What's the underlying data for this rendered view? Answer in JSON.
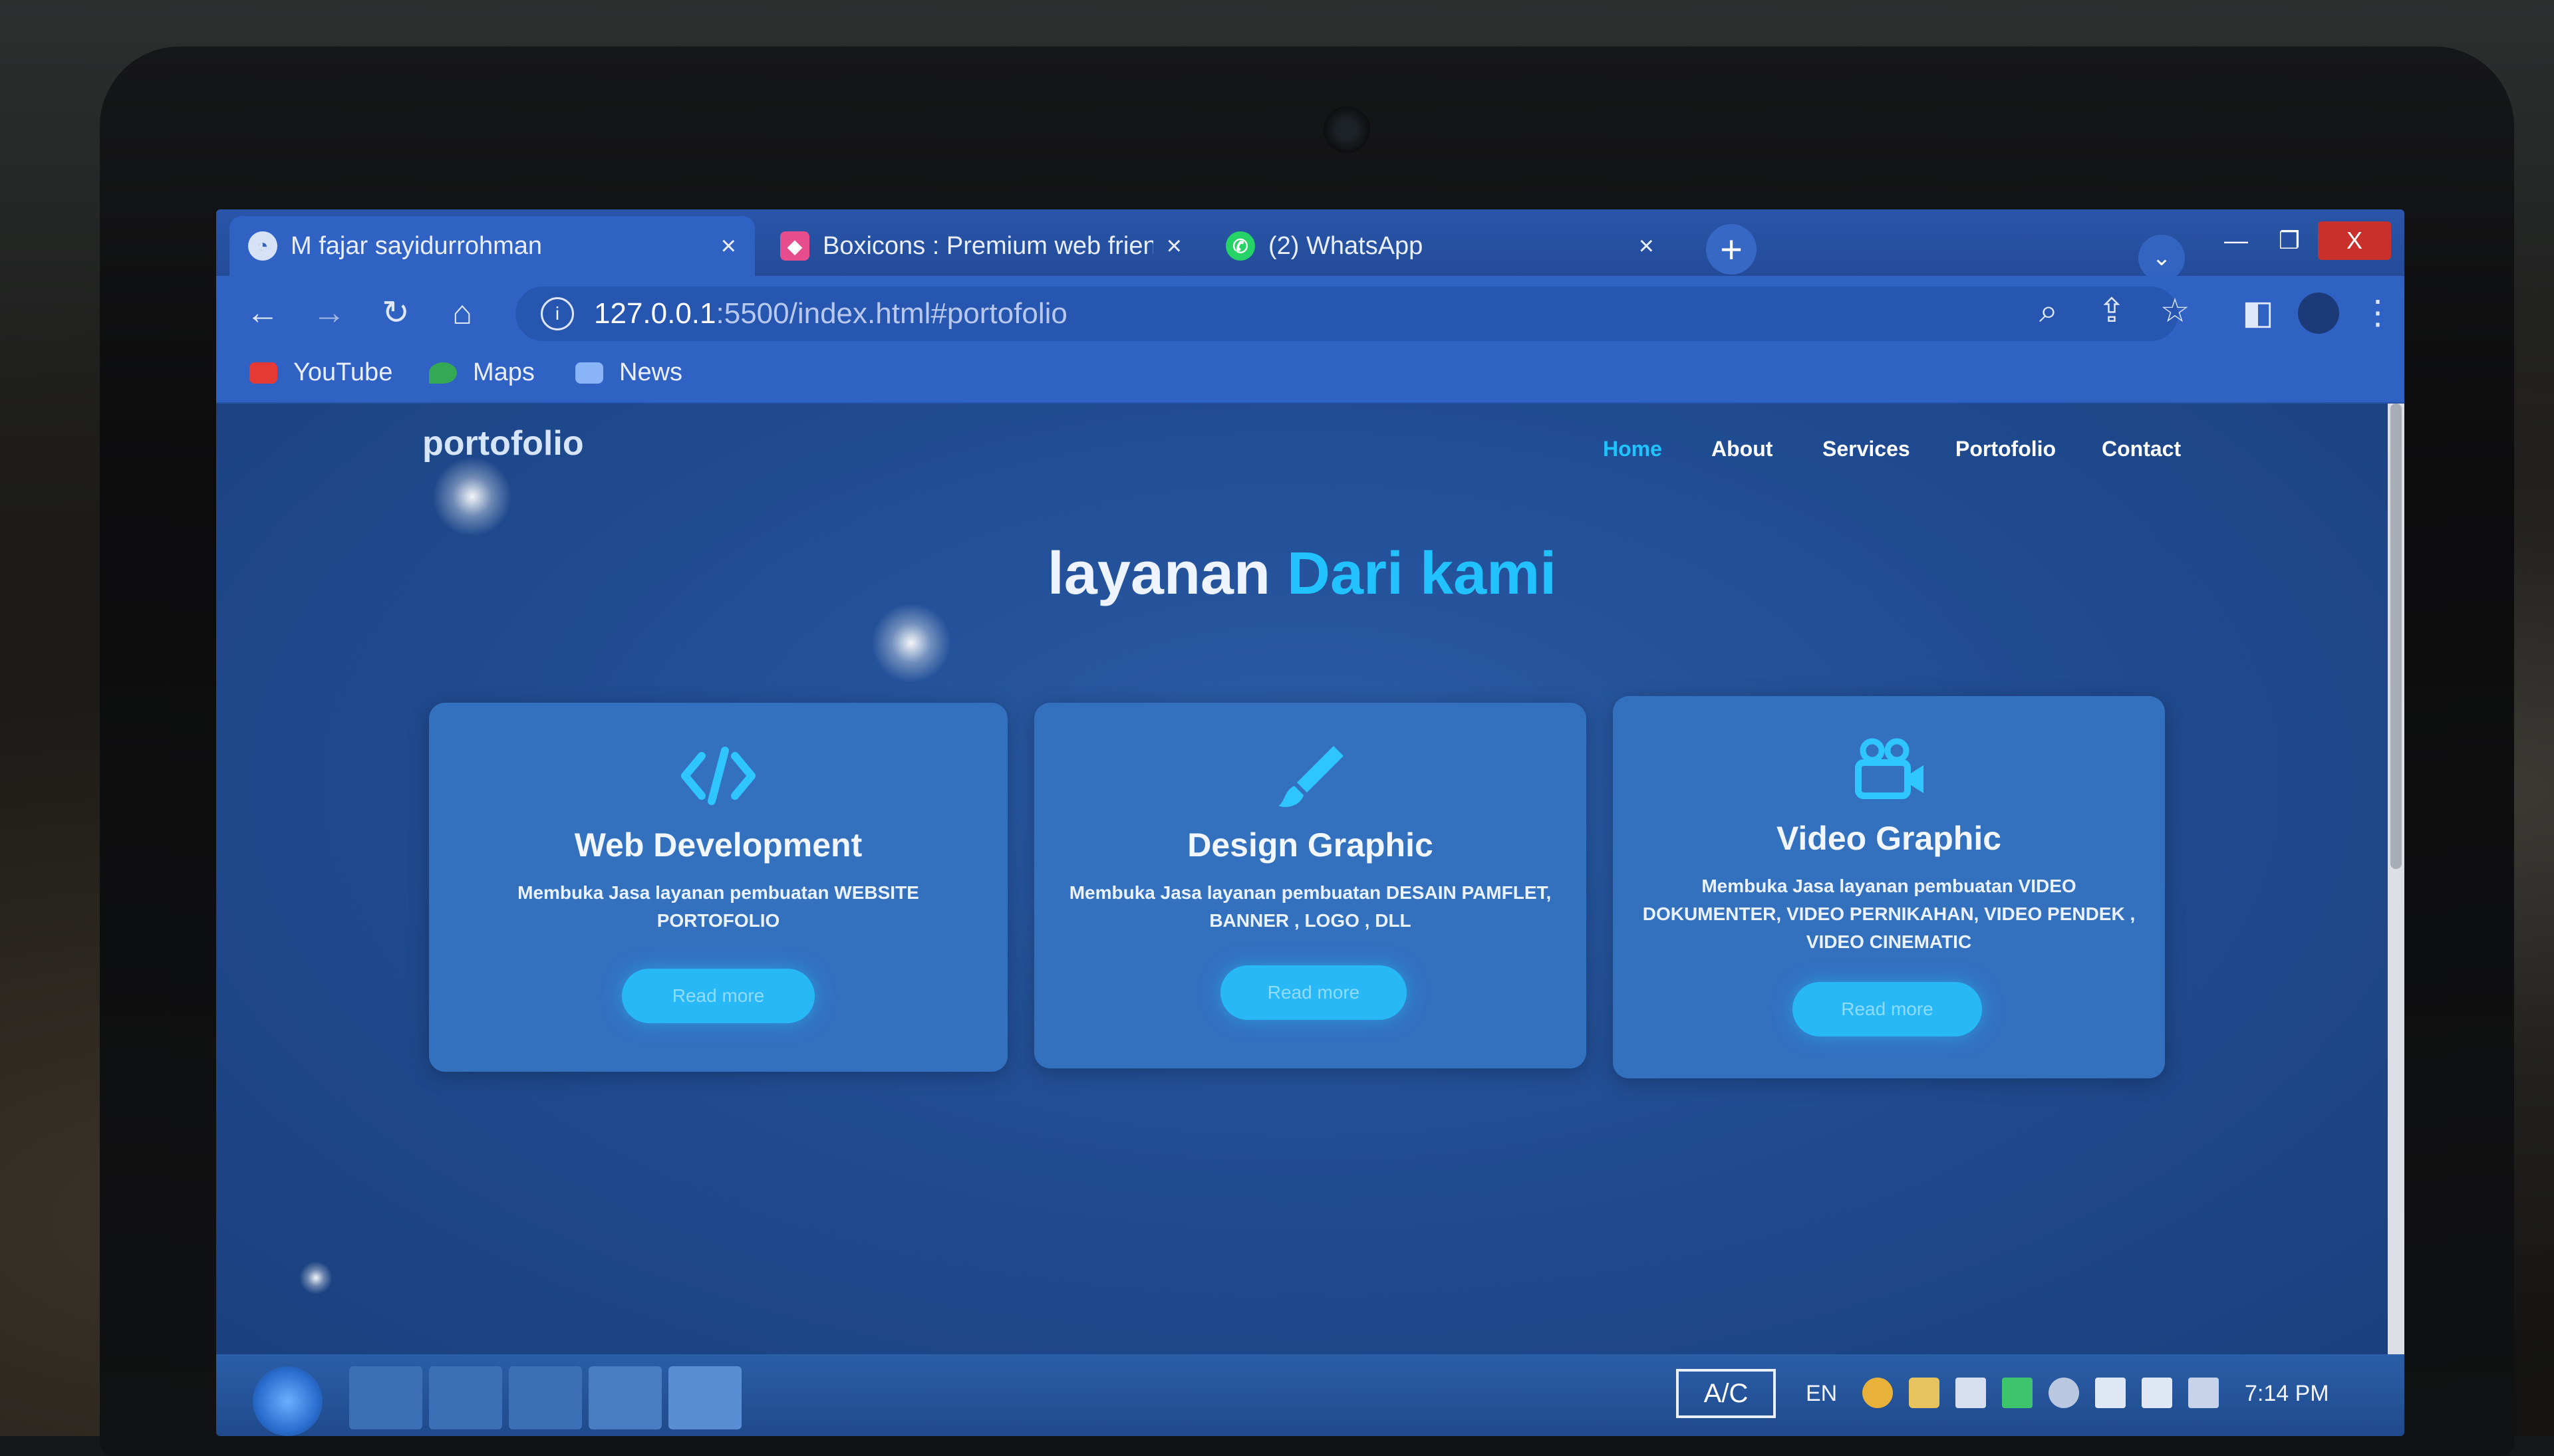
{
  "browser": {
    "tabs": [
      {
        "title": "M fajar sayidurrohman",
        "close": "×"
      },
      {
        "title": "Boxicons : Premium web friendly",
        "close": "×"
      },
      {
        "title": "(2) WhatsApp",
        "close": "×"
      }
    ],
    "new_tab": "+",
    "tab_search": "⌄",
    "window_controls": {
      "minimize": "—",
      "maximize": "❐",
      "close": "X"
    },
    "nav_icons": {
      "back": "←",
      "forward": "→",
      "reload": "↻",
      "home": "⌂"
    },
    "url_host": "127.0.0.1",
    "url_path": ":5500/index.html#portofolio",
    "url_info": "i",
    "toolbar_icons": {
      "zoom": "⌕",
      "share": "⇪",
      "star": "☆",
      "sidepanel": "◧",
      "menu": "⋮"
    },
    "bookmarks": [
      {
        "label": "YouTube",
        "color": "#e53935"
      },
      {
        "label": "Maps",
        "color": "#34a853"
      },
      {
        "label": "News",
        "color": "#8ab4f8"
      }
    ]
  },
  "page": {
    "logo": "portofolio",
    "nav": [
      "Home",
      "About",
      "Services",
      "Portofolio",
      "Contact"
    ],
    "active_nav": "Home",
    "heading_main": "layanan ",
    "heading_accent": "Dari kami",
    "cards": [
      {
        "icon": "code-icon",
        "title": "Web Development",
        "desc": "Membuka Jasa layanan pembuatan WEBSITE PORTOFOLIO",
        "button": "Read more"
      },
      {
        "icon": "brush-icon",
        "title": "Design Graphic",
        "desc": "Membuka Jasa layanan pembuatan DESAIN PAMFLET, BANNER , LOGO , DLL",
        "button": "Read more"
      },
      {
        "icon": "video-camera-icon",
        "title": "Video Graphic",
        "desc": "Membuka Jasa layanan pembuatan VIDEO DOKUMENTER, VIDEO PERNIKAHAN, VIDEO PENDEK , VIDEO CINEMATIC",
        "button": "Read more"
      }
    ]
  },
  "taskbar": {
    "ime": "A/C",
    "lang": "EN",
    "time": "7:14 PM"
  },
  "colors": {
    "accent": "#21c2ff",
    "card": "#3371bf",
    "page_bg": "#214d94",
    "chrome": "#2f62c3"
  }
}
